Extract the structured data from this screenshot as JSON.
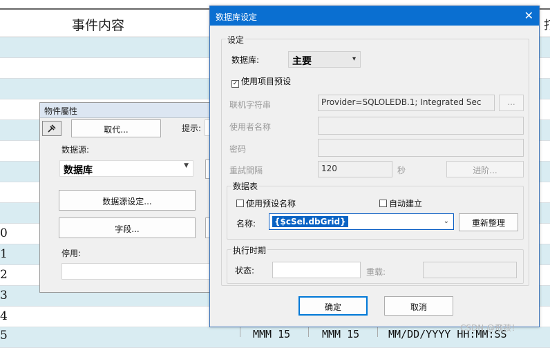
{
  "background": {
    "header_title": "事件内容",
    "header_partial_right": "打",
    "row_numbers": [
      "0",
      "1",
      "2",
      "3",
      "4",
      "5"
    ],
    "bottom_cells": [
      "MMM 15",
      "MMM 15",
      "MM/DD/YYYY HH:MM:SS"
    ]
  },
  "object_window": {
    "title": "物件屬性",
    "tool_icon": "pin-icon",
    "replace_button": "取代...",
    "hint_label": "提示:",
    "datasource_label": "数据源:",
    "datasource_value": "数据库",
    "datasource_settings_button": "数据源设定...",
    "fields_button": "字段...",
    "disable_label": "停用:"
  },
  "dialog": {
    "title": "数据库设定",
    "close_icon": "close-icon",
    "settings_group": "设定",
    "database_label": "数据库:",
    "database_value": "主要",
    "use_project_default": "使用项目预设",
    "use_project_default_checked": true,
    "connection_string_label": "联机字符串",
    "connection_string_value": "Provider=SQLOLEDB.1; Integrated Sec",
    "connection_browse_button": "...",
    "username_label": "使用者名称",
    "username_value": "",
    "password_label": "密码",
    "password_value": "",
    "retry_interval_label": "重試間隔",
    "retry_interval_value": "120",
    "seconds_label": "秒",
    "advanced_button": "进阶...",
    "table_group": "数据表",
    "use_default_name": "使用预设名称",
    "use_default_name_checked": false,
    "auto_create": "自动建立",
    "auto_create_checked": false,
    "name_label": "名称:",
    "name_value": "{$cSel.dbGrid}",
    "reorganize_button": "重新整理",
    "runtime_group": "执行时期",
    "status_label": "状态:",
    "status_value": "",
    "reload_label": "重载:",
    "reload_value": "",
    "ok_button": "确定",
    "cancel_button": "取消"
  },
  "watermark": "CSDN @飛孩！",
  "colors": {
    "title_bar": "#0a6fd1",
    "row_alt": "#d9ecf2",
    "selection": "#0a63c4"
  }
}
